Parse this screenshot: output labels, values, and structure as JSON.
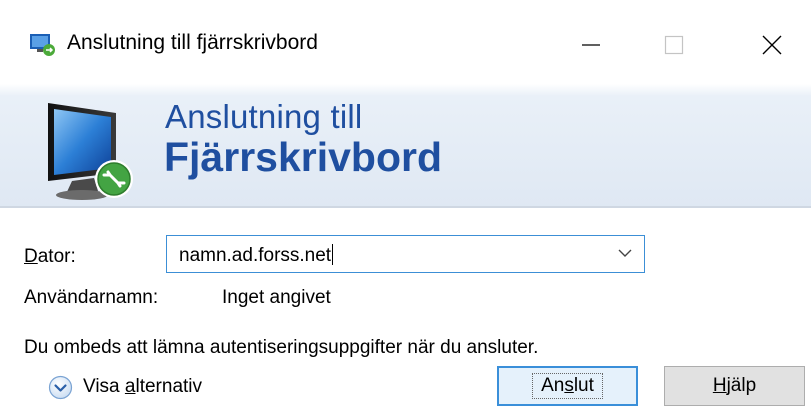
{
  "window": {
    "title": "Anslutning till fjärrskrivbord",
    "icon": "remote-desktop-icon",
    "controls": [
      "minimize-icon",
      "maximize-icon",
      "close-icon"
    ]
  },
  "banner": {
    "line1": "Anslutning till",
    "line2": "Fjärrskrivbord",
    "icon": "monitor-remote-icon",
    "color": "#1f4fa0"
  },
  "form": {
    "computer_label_accel": "D",
    "computer_label_rest": "ator:",
    "computer_value": "namn.ad.forss.net",
    "username_label": "Användarnamn:",
    "username_value": "Inget angivet",
    "notice": "Du ombeds att lämna autentiseringsuppgifter när du ansluter."
  },
  "options": {
    "label_pre": "Visa ",
    "label_accel": "a",
    "label_post": "lternativ",
    "icon": "chevron-down-circle-icon"
  },
  "buttons": {
    "connect_pre": "An",
    "connect_accel": "s",
    "connect_post": "lut",
    "help_accel": "H",
    "help_post": "jälp"
  },
  "colors": {
    "accent": "#3a8fd9",
    "focus_border": "#3c8fd6"
  }
}
